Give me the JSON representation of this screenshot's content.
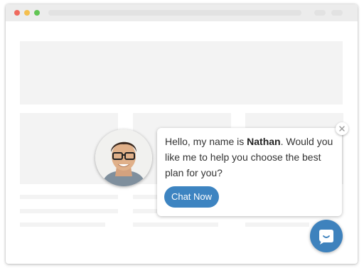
{
  "chat": {
    "greeting_prefix": "Hello, my name is ",
    "agent_name": "Nathan",
    "greeting_suffix": ". Would you like me to help you choose the best plan for you?",
    "button_label": "Chat Now"
  },
  "icons": {
    "close": "close-icon",
    "launcher": "chat-bubble-icon",
    "avatar": "agent-avatar"
  },
  "colors": {
    "accent": "#3d84c1",
    "placeholder": "#f3f3f3",
    "titlebar": "#ececec"
  }
}
